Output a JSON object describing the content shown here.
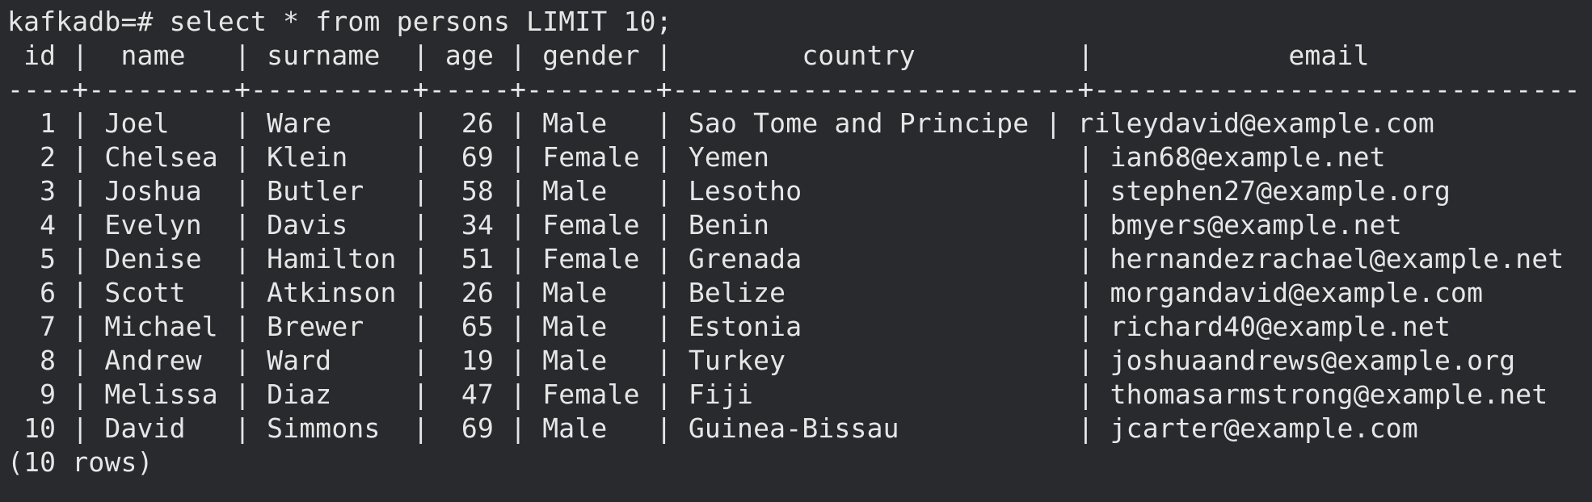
{
  "terminal": {
    "prompt": "kafkadb=#",
    "command": " select * from persons LIMIT 10;",
    "header_line": " id |  name   | surname  | age | gender |        country          |            email",
    "separator_line": "----+---------+----------+-----+--------+-------------------------+------------------------------",
    "rows": [
      "  1 | Joel    | Ware     |  26 | Male   | Sao Tome and Principe | rileydavid@example.com",
      "  2 | Chelsea | Klein    |  69 | Female | Yemen                   | ian68@example.net",
      "  3 | Joshua  | Butler   |  58 | Male   | Lesotho                 | stephen27@example.org",
      "  4 | Evelyn  | Davis    |  34 | Female | Benin                   | bmyers@example.net",
      "  5 | Denise  | Hamilton |  51 | Female | Grenada                 | hernandezrachael@example.net",
      "  6 | Scott   | Atkinson |  26 | Male   | Belize                  | morgandavid@example.com",
      "  7 | Michael | Brewer   |  65 | Male   | Estonia                 | richard40@example.net",
      "  8 | Andrew  | Ward     |  19 | Male   | Turkey                  | joshuaandrews@example.org",
      "  9 | Melissa | Diaz     |  47 | Female | Fiji                    | thomasarmstrong@example.net",
      " 10 | David   | Simmons  |  69 | Male   | Guinea-Bissau           | jcarter@example.com"
    ],
    "footer": "(10 rows)"
  }
}
